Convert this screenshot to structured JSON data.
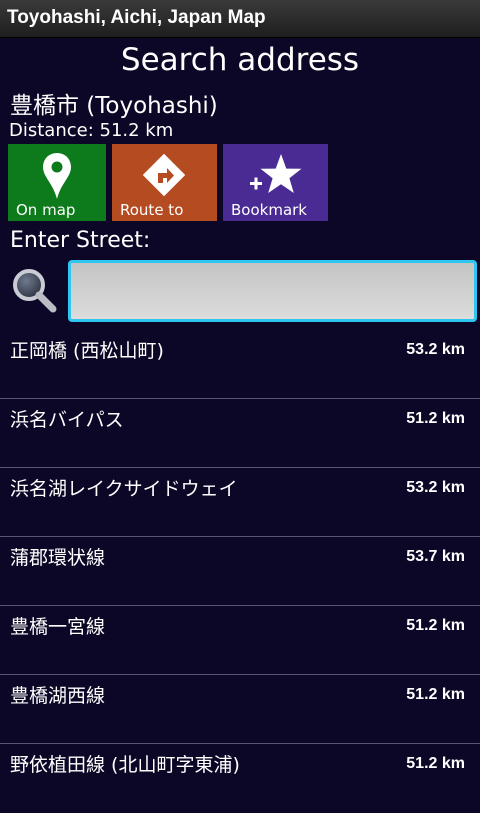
{
  "window": {
    "title": "Toyohashi, Aichi, Japan Map"
  },
  "header": {
    "title": "Search address",
    "city": "豊橋市 (Toyohashi)",
    "distance": "Distance: 51.2 km"
  },
  "actions": [
    {
      "label": "On map",
      "icon": "map-pin-icon",
      "color": "#0d7a1b"
    },
    {
      "label": "Route to",
      "icon": "route-sign-icon",
      "color": "#b54b21"
    },
    {
      "label": "Bookmark",
      "icon": "star-plus-icon",
      "color": "#4a2b93"
    }
  ],
  "street": {
    "label": "Enter Street:",
    "value": "",
    "placeholder": ""
  },
  "streets": [
    {
      "name": "正岡橋 (西松山町)",
      "distance": "53.2 km"
    },
    {
      "name": "浜名バイパス",
      "distance": "51.2 km"
    },
    {
      "name": "浜名湖レイクサイドウェイ",
      "distance": "53.2 km"
    },
    {
      "name": "蒲郡環状線",
      "distance": "53.7 km"
    },
    {
      "name": "豊橋一宮線",
      "distance": "51.2 km"
    },
    {
      "name": "豊橋湖西線",
      "distance": "51.2 km"
    },
    {
      "name": "野依植田線 (北山町字東浦)",
      "distance": "51.2 km"
    }
  ],
  "colors": {
    "background": "#0c0726",
    "accent": "#2ec6f0"
  }
}
